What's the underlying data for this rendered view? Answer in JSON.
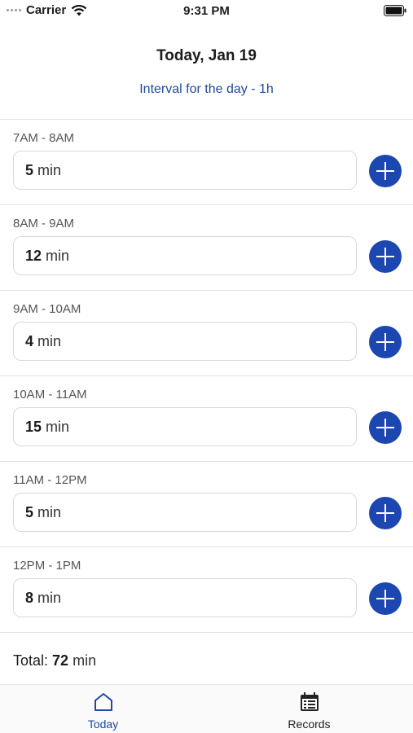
{
  "status_bar": {
    "carrier": "Carrier",
    "time": "9:31 PM"
  },
  "header": {
    "title": "Today, Jan 19",
    "subtitle": "Interval for the day - 1h"
  },
  "intervals": [
    {
      "label": "7AM - 8AM",
      "value": "5",
      "unit": "min"
    },
    {
      "label": "8AM - 9AM",
      "value": "12",
      "unit": "min"
    },
    {
      "label": "9AM - 10AM",
      "value": "4",
      "unit": "min"
    },
    {
      "label": "10AM - 11AM",
      "value": "15",
      "unit": "min"
    },
    {
      "label": "11AM - 12PM",
      "value": "5",
      "unit": "min"
    },
    {
      "label": "12PM - 1PM",
      "value": "8",
      "unit": "min"
    }
  ],
  "total": {
    "label": "Total:",
    "value": "72",
    "unit": "min"
  },
  "tabs": [
    {
      "label": "Today",
      "icon": "home-icon",
      "active": true
    },
    {
      "label": "Records",
      "icon": "calendar-icon",
      "active": false
    }
  ],
  "colors": {
    "accent": "#1c46b0",
    "link": "#1f49a6"
  }
}
